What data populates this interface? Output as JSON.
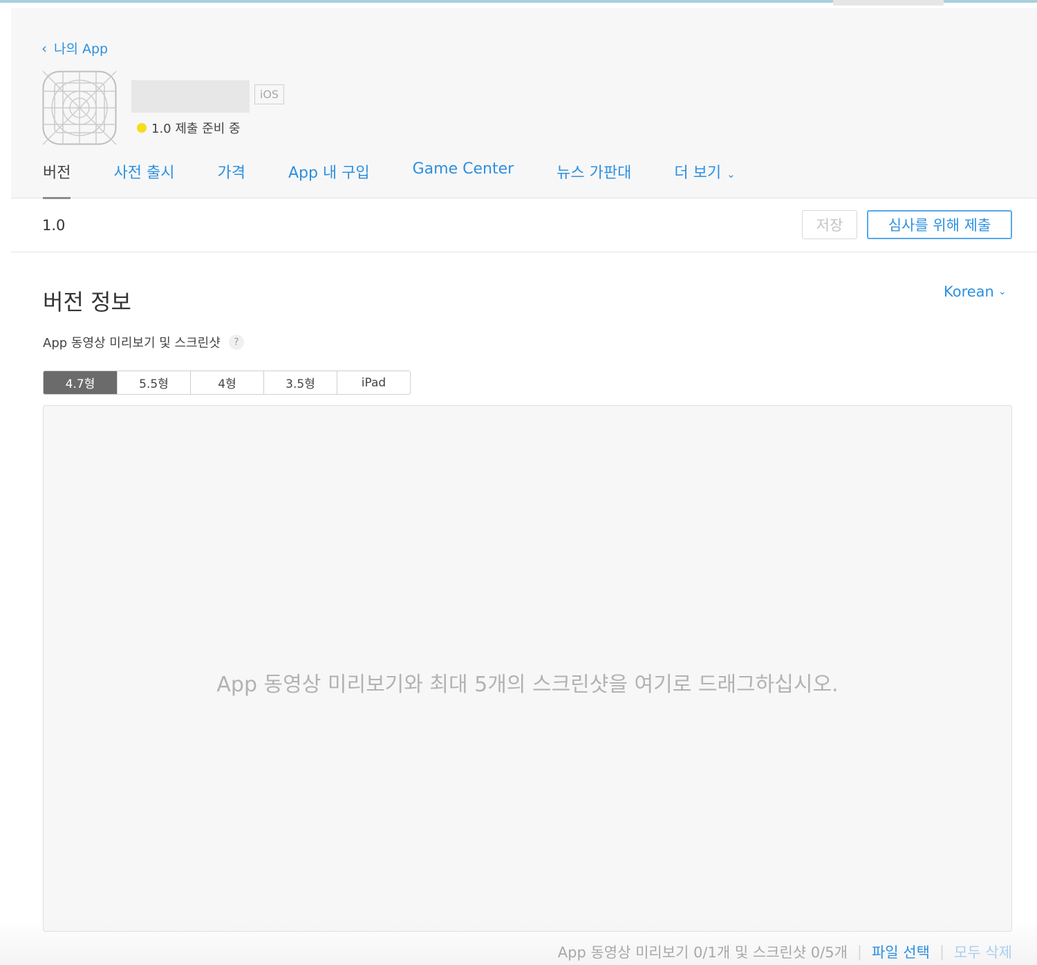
{
  "header": {
    "back_link": "나의 App",
    "platform_badge": "iOS",
    "status_text": "1.0 제출 준비 중",
    "status_color": "#f5dd1c",
    "tabs": [
      {
        "label": "버전",
        "active": true
      },
      {
        "label": "사전 출시"
      },
      {
        "label": "가격"
      },
      {
        "label": "App 내 구입"
      },
      {
        "label": "Game Center"
      },
      {
        "label": "뉴스 가판대"
      },
      {
        "label": "더 보기",
        "has_dropdown": true
      }
    ]
  },
  "version_bar": {
    "version": "1.0",
    "save_label": "저장",
    "submit_label": "심사를 위해 제출"
  },
  "main": {
    "section_title": "버전 정보",
    "language": "Korean",
    "subheading": "App 동영상 미리보기 및 스크린샷",
    "help_glyph": "?",
    "size_tabs": [
      {
        "label": "4.7형",
        "active": true
      },
      {
        "label": "5.5형"
      },
      {
        "label": "4형"
      },
      {
        "label": "3.5형"
      },
      {
        "label": "iPad"
      }
    ],
    "dropzone_text": "App 동영상 미리보기와 최대 5개의 스크린샷을 여기로 드래그하십시오.",
    "footer": {
      "count_text": "App 동영상 미리보기 0/1개 및 스크린샷 0/5개",
      "choose_file": "파일 선택",
      "delete_all": "모두 삭제"
    }
  },
  "colors": {
    "accent": "#2d8fe0",
    "active_size_tab": "#6b6b6b"
  }
}
